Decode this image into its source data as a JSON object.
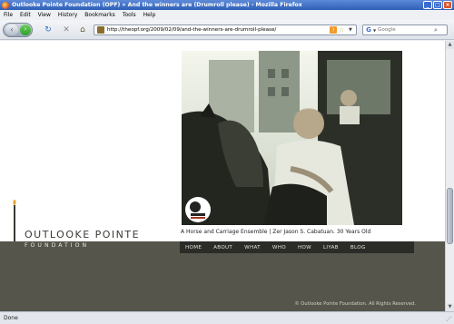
{
  "window": {
    "title": "Outlooke Pointe Foundation (OPF) » And the winners are (Drumroll please) - Mozilla Firefox",
    "buttons": [
      "_",
      "□",
      "×"
    ]
  },
  "menu": [
    "File",
    "Edit",
    "View",
    "History",
    "Bookmarks",
    "Tools",
    "Help"
  ],
  "toolbar": {
    "url": "http://theopf.org/2009/02/09/and-the-winners-are-drumroll-please/",
    "search_placeholder": "Google",
    "icons": [
      "back-icon",
      "forward-icon",
      "reload-icon",
      "stop-icon",
      "home-icon",
      "rss-icon",
      "star-icon",
      "google-icon",
      "magnifier-icon"
    ]
  },
  "page": {
    "brand_main": "OUTLOOKE POINTE",
    "brand_sub": "FOUNDATION",
    "caption": "A Horse and Carriage Ensemble | Zer Jason S. Cabatuan. 30 Years Old",
    "badge_text": "OUTLOOKE POINTE",
    "nav": [
      "HOME",
      "ABOUT",
      "WHAT",
      "WHO",
      "HOW",
      "LIYAB",
      "BLOG"
    ],
    "copyright": "© Outlooke Pointe Foundation. All Rights Reserved."
  },
  "status": {
    "text": "Done"
  },
  "colors": {
    "titlebar": "#2f5fb8",
    "nav_strip": "#2b2b27",
    "footer": "#55554c"
  }
}
